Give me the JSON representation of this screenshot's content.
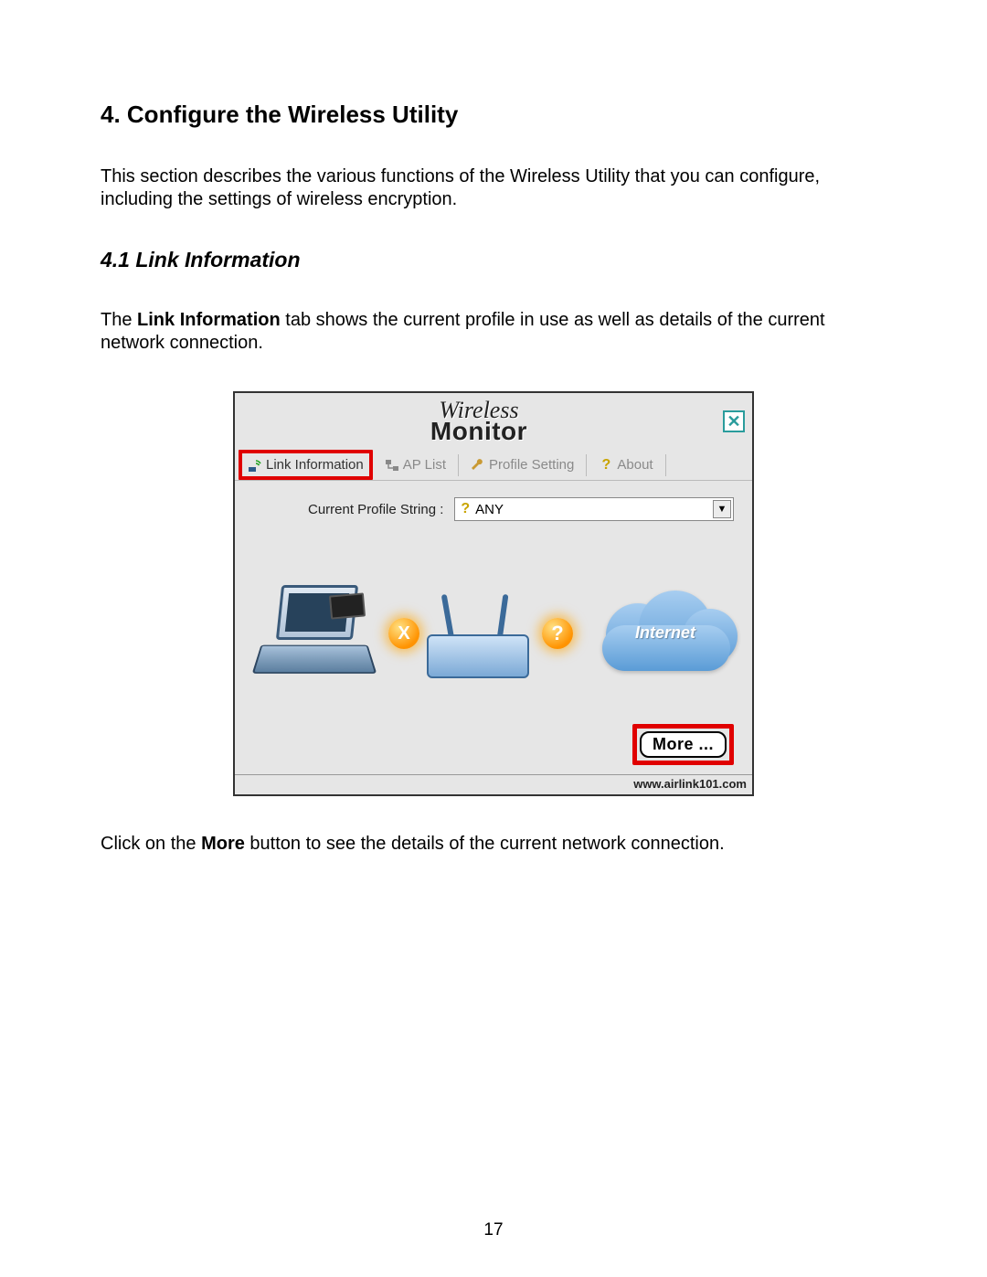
{
  "doc": {
    "heading": "4. Configure the Wireless Utility",
    "intro": "This section describes the various functions of the Wireless Utility that you can configure, including the settings of wireless encryption.",
    "sub_heading": "4.1 Link Information",
    "sub_prefix": "The ",
    "sub_bold": "Link Information",
    "sub_suffix": " tab shows the current profile in use as well as details of the current network connection.",
    "after_prefix": "Click on the ",
    "after_bold": "More",
    "after_suffix": " button to see the details of the current network connection.",
    "page_number": "17"
  },
  "app": {
    "logo_top": "Wireless",
    "logo_bottom": "Monitor",
    "close": "✕",
    "tabs": {
      "link_info": "Link Information",
      "ap_list": "AP List",
      "profile_setting": "Profile Setting",
      "about": "About"
    },
    "profile_label": "Current Profile String :",
    "profile_value": "ANY",
    "dropdown_arrow": "▼",
    "status_x": "X",
    "status_q": "?",
    "cloud_label": "Internet",
    "more_button": "More ...",
    "footer_url": "www.airlink101.com"
  }
}
